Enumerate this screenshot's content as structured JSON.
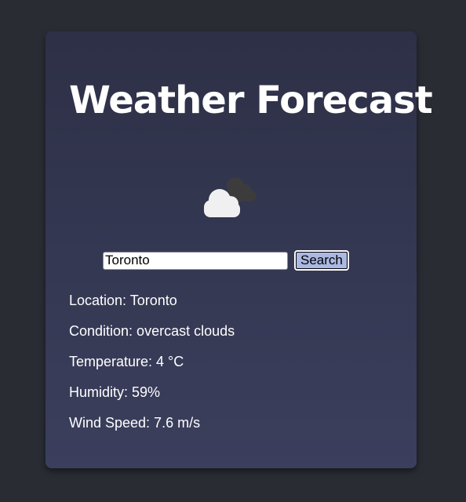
{
  "title": "Weather Forecast",
  "icon": {
    "name": "overcast-clouds-icon",
    "front_cloud_color": "#f0f0f0",
    "back_cloud_color": "#3c3c3c"
  },
  "search": {
    "value": "Toronto",
    "button_label": "Search"
  },
  "details": {
    "location": "Location: Toronto",
    "condition": "Condition: overcast clouds",
    "temperature": "Temperature: 4 °C",
    "humidity": "Humidity: 59%",
    "wind_speed": "Wind Speed: 7.6 m/s"
  },
  "colors": {
    "page_background": "#2a2c34",
    "card_top": "#2d3046",
    "card_bottom": "#3b3f5d",
    "button_background": "#aab8e2",
    "text": "#ffffff"
  }
}
